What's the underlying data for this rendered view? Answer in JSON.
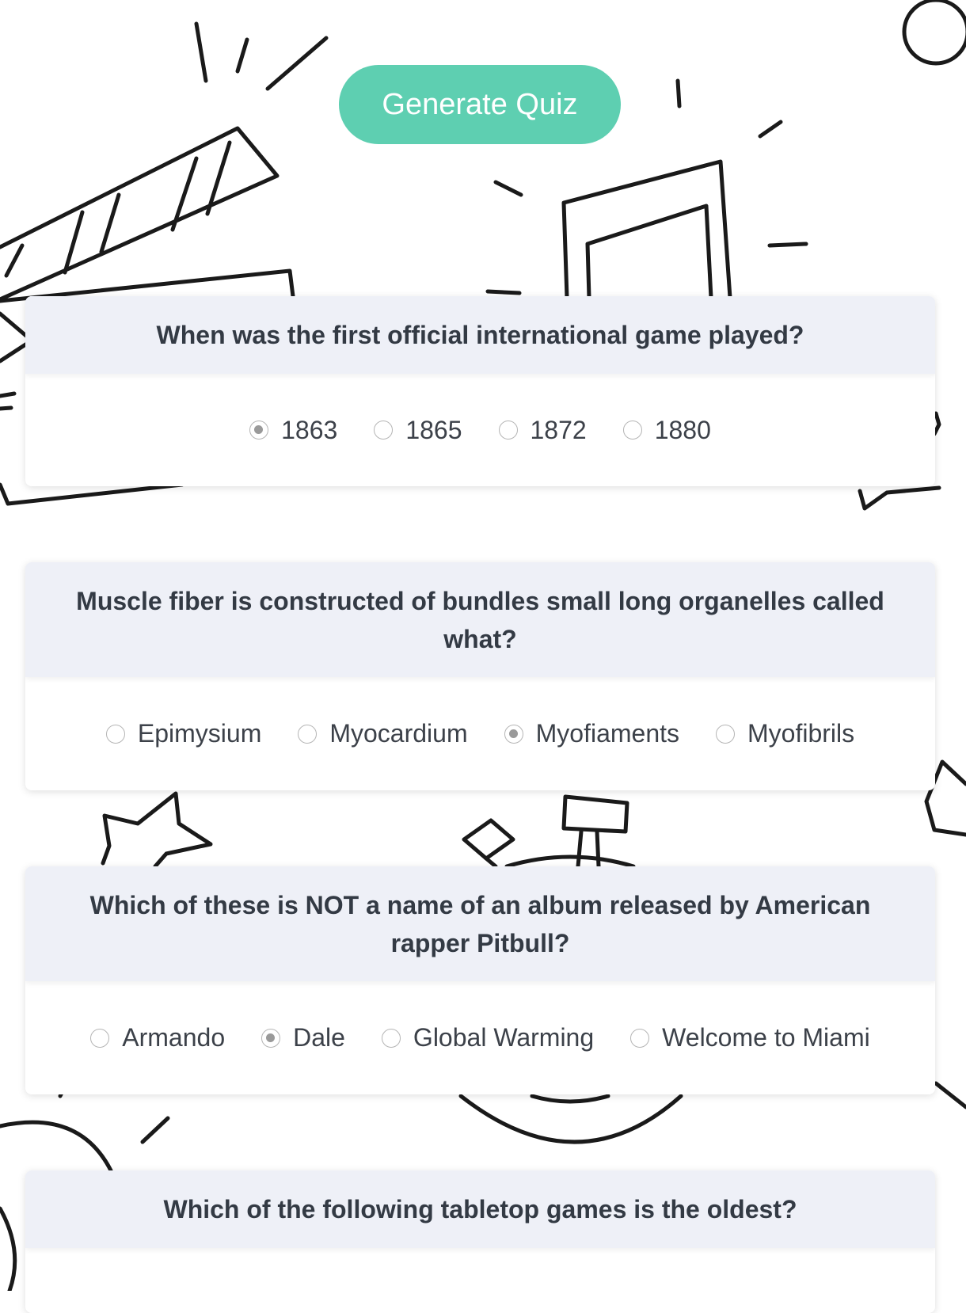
{
  "generate_button": {
    "label": "Generate Quiz"
  },
  "colors": {
    "accent": "#5ecfb1",
    "header_bg": "#eef0f7",
    "text": "#333a44"
  },
  "questions": [
    {
      "question": "When was the first official international game played?",
      "options": [
        "1863",
        "1865",
        "1872",
        "1880"
      ],
      "selected": "1863"
    },
    {
      "question": "Muscle fiber is constructed of bundles small long organelles called what?",
      "options": [
        "Epimysium",
        "Myocardium",
        "Myofiaments",
        "Myofibrils"
      ],
      "selected": "Myofiaments"
    },
    {
      "question": "Which of these is NOT a name of an album released by American rapper Pitbull?",
      "options": [
        "Armando",
        "Dale",
        "Global Warming",
        "Welcome to Miami"
      ],
      "selected": "Dale"
    },
    {
      "question": "Which of the following tabletop games is the oldest?",
      "options": [],
      "selected": null
    }
  ]
}
